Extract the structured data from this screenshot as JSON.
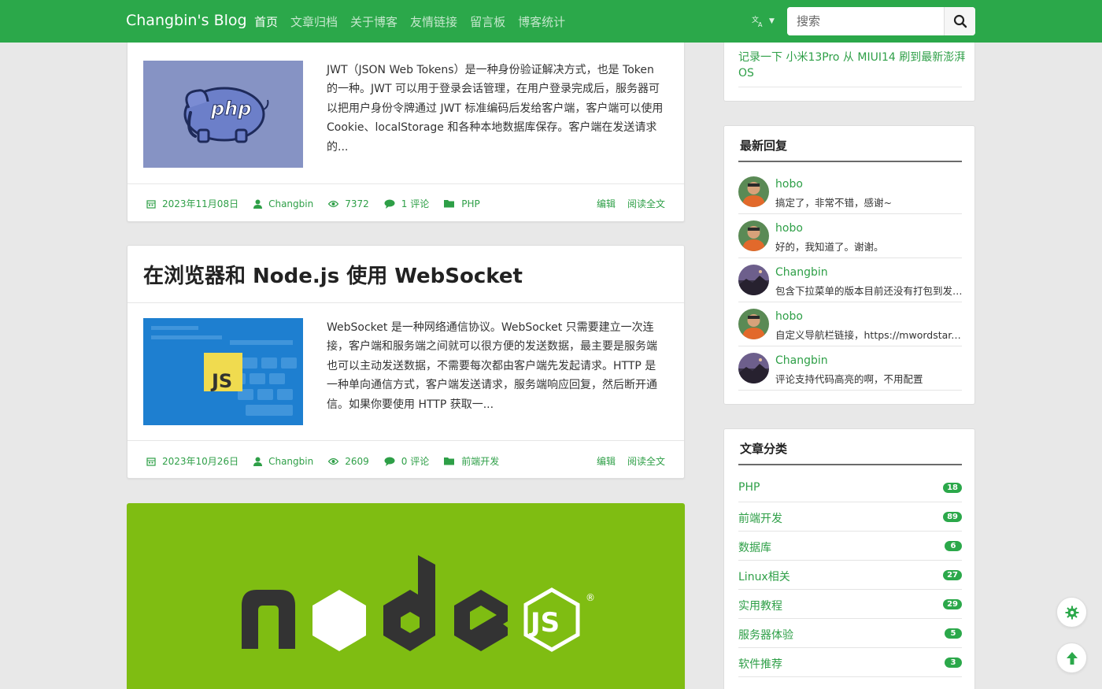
{
  "navbar": {
    "brand": "Changbin's Blog",
    "links": [
      "首页",
      "文章归档",
      "关于博客",
      "友情链接",
      "留言板",
      "博客统计"
    ],
    "lang_icon": "translate-icon",
    "search_placeholder": "搜索"
  },
  "posts": [
    {
      "excerpt": "JWT（JSON Web Tokens）是一种身份验证解决方式，也是 Token 的一种。JWT 可以用于登录会话管理，在用户登录完成后，服务器可以把用户身份令牌通过 JWT 标准编码后发给客户端，客户端可以使用 Cookie、localStorage 和各种本地数据库保存。客户端在发送请求的...",
      "date": "2023年11月08日",
      "author": "Changbin",
      "views": "7372",
      "comments": "1 评论",
      "category": "PHP",
      "edit": "编辑",
      "read_more": "阅读全文",
      "thumb_text": "php"
    },
    {
      "title": "在浏览器和 Node.js 使用 WebSocket",
      "excerpt": "WebSocket 是一种网络通信协议。WebSocket 只需要建立一次连接，客户端和服务端之间就可以很方便的发送数据，最主要是服务端也可以主动发送数据，不需要每次都由客户端先发起请求。HTTP 是一种单向通信方式，客户端发送请求，服务端响应回复，然后断开通信。如果你要使用 HTTP 获取一...",
      "date": "2023年10月26日",
      "author": "Changbin",
      "views": "2609",
      "comments": "0 评论",
      "category": "前端开发",
      "edit": "编辑",
      "read_more": "阅读全文",
      "thumb_text": "JS"
    }
  ],
  "banner": {
    "logo_text": "node",
    "badge_text": "JS",
    "registered": "®",
    "bg_color": "#7fbd12"
  },
  "sidebar": {
    "top_link": "记录一下 小米13Pro 从 MIUI14 刷到最新澎湃OS",
    "recent_title": "最新回复",
    "replies": [
      {
        "name": "hobo",
        "text": "搞定了，非常不错，感谢~",
        "avatar": "person"
      },
      {
        "name": "hobo",
        "text": "好的，我知道了。谢谢。",
        "avatar": "person"
      },
      {
        "name": "Changbin",
        "text": "包含下拉菜单的版本目前还没有打包到发布版本中",
        "avatar": "landscape"
      },
      {
        "name": "hobo",
        "text": "自定义导航栏链接，https://mwordstar.com",
        "avatar": "person"
      },
      {
        "name": "Changbin",
        "text": "评论支持代码高亮的啊，不用配置",
        "avatar": "landscape"
      }
    ],
    "categories_title": "文章分类",
    "categories": [
      {
        "label": "PHP",
        "count": "18"
      },
      {
        "label": "前端开发",
        "count": "89"
      },
      {
        "label": "数据库",
        "count": "6"
      },
      {
        "label": "Linux相关",
        "count": "27"
      },
      {
        "label": "实用教程",
        "count": "29"
      },
      {
        "label": "服务器体验",
        "count": "5"
      },
      {
        "label": "软件推荐",
        "count": "3"
      }
    ]
  },
  "floating": {
    "settings_icon": "gear-icon",
    "top_icon": "arrow-up-icon"
  },
  "colors": {
    "primary": "#2ba84a",
    "link": "#2e9f47"
  }
}
